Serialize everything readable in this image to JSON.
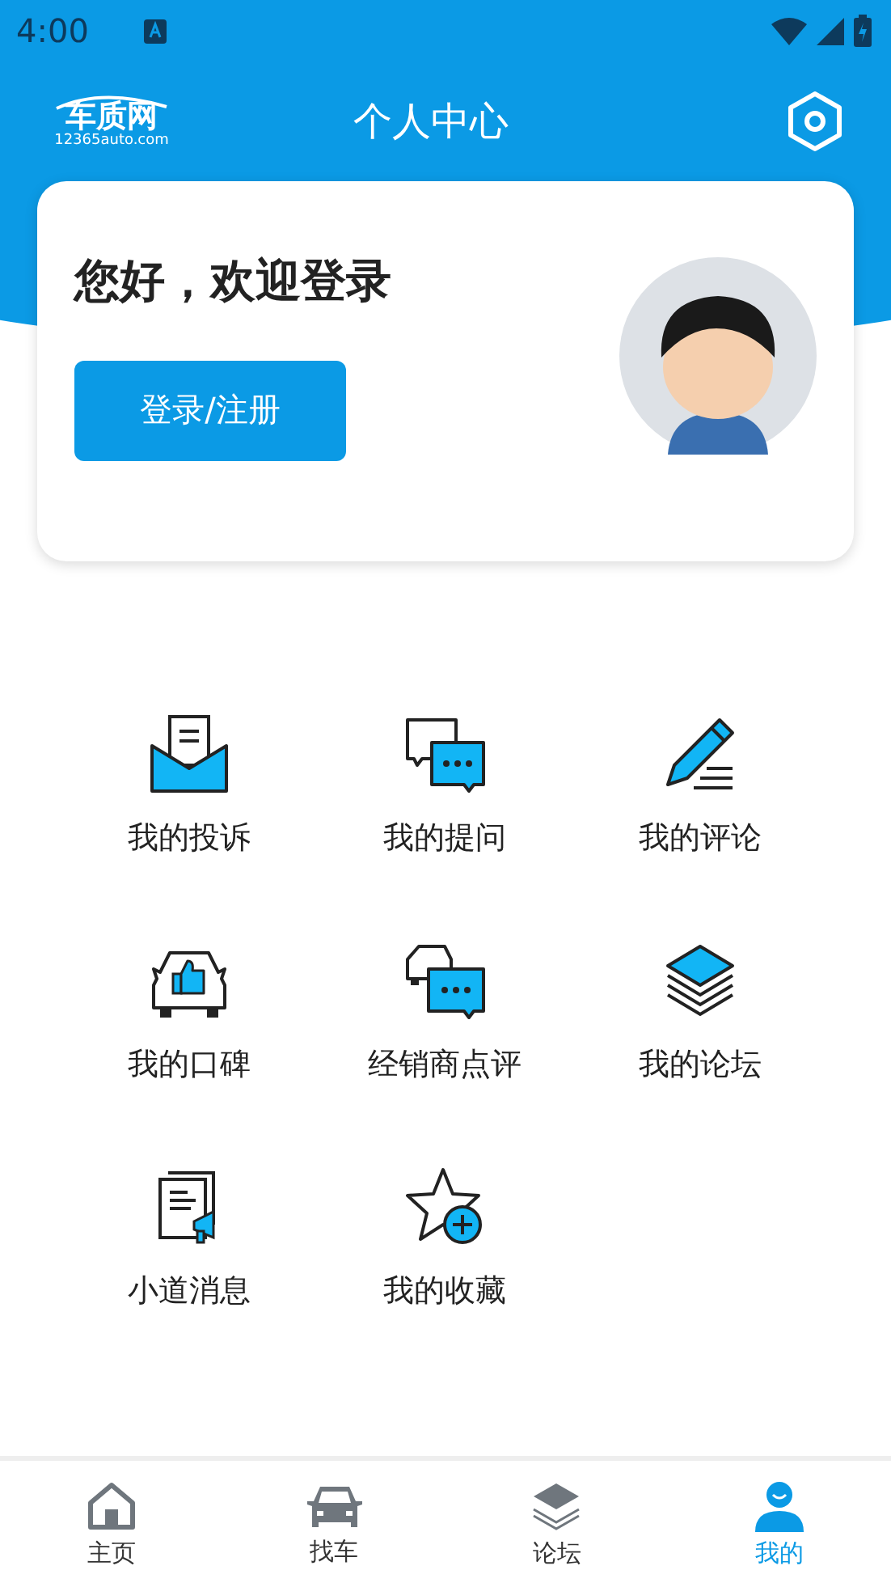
{
  "status_bar": {
    "time": "4:00"
  },
  "header": {
    "logo_text": "车质网",
    "logo_sub": "12365auto.com",
    "title": "个人中心"
  },
  "profile": {
    "greeting": "您好，欢迎登录",
    "login_button": "登录/注册"
  },
  "menu": [
    {
      "label": "我的投诉"
    },
    {
      "label": "我的提问"
    },
    {
      "label": "我的评论"
    },
    {
      "label": "我的口碑"
    },
    {
      "label": "经销商点评"
    },
    {
      "label": "我的论坛"
    },
    {
      "label": "小道消息"
    },
    {
      "label": "我的收藏"
    }
  ],
  "bottom_nav": [
    {
      "label": "主页",
      "selected": false
    },
    {
      "label": "找车",
      "selected": false
    },
    {
      "label": "论坛",
      "selected": false
    },
    {
      "label": "我的",
      "selected": true
    }
  ]
}
